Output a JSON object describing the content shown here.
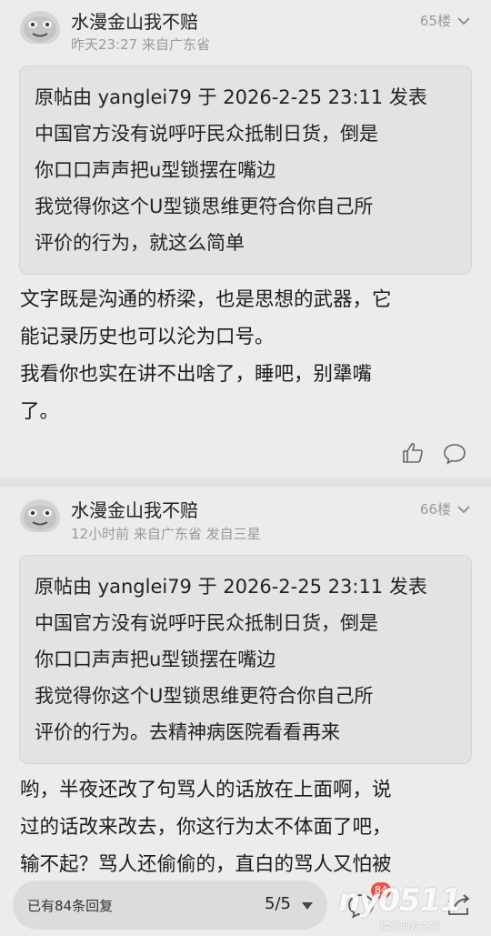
{
  "posts": [
    {
      "username": "水漫金山我不赔",
      "meta": "昨天23:27 来自广东省",
      "floor": "65楼",
      "quote_lines": [
        "原帖由 yanglei79 于 2026-2-25 23:11 发表",
        "中国官方没有说呼吁民众抵制日货，倒是",
        "你口口声声把u型锁摆在嘴边",
        "我觉得你这个U型锁思维更符合你自己所",
        "评价的行为，就这么简单"
      ],
      "body_lines": [
        "文字既是沟通的桥梁，也是思想的武器，它",
        "能记录历史也可以沦为口号。",
        "我看你也实在讲不出啥了，睡吧，别犟嘴",
        "了。"
      ]
    },
    {
      "username": "水漫金山我不赔",
      "meta": "12小时前 来自广东省 发自三星",
      "floor": "66楼",
      "quote_lines": [
        "原帖由 yanglei79 于 2026-2-25 23:11 发表",
        "中国官方没有说呼吁民众抵制日货，倒是",
        "你口口声声把u型锁摆在嘴边",
        "我觉得你这个U型锁思维更符合你自己所",
        "评价的行为。去精神病医院看看再来"
      ],
      "body_lines": [
        "哟，半夜还改了句骂人的话放在上面啊，说",
        "过的话改来改去，你这行为太不体面了吧，",
        "输不起？骂人还偷偷的，直白的骂人又怕被"
      ]
    }
  ],
  "bottom_bar": {
    "reply_count_label": "已有84条回复",
    "page_indicator": "5/5",
    "badge_count": "84"
  },
  "watermark": {
    "main": "ny0511",
    "sub": "镇江网友之家"
  },
  "icons": {
    "like": "thumbs-up-icon",
    "comment": "comment-bubble-icon",
    "dropdown": "chevron-down-icon",
    "share": "share-icon"
  },
  "colors": {
    "background": "#ececec",
    "quote_background": "#e3e3e3",
    "meta_text": "#9a9a9a",
    "badge": "#e8534a"
  }
}
